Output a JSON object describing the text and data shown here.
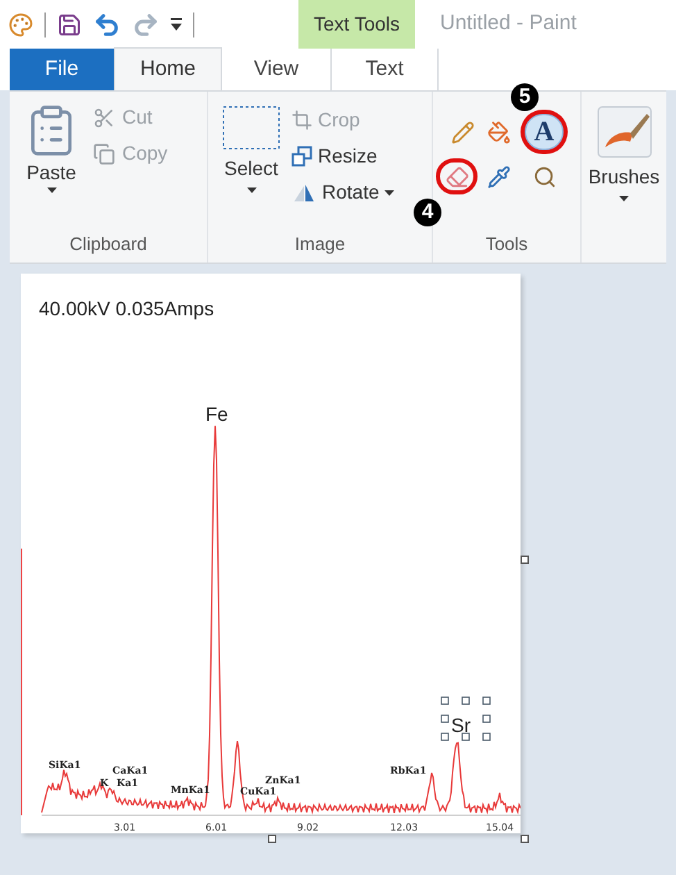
{
  "quick_access": [
    {
      "kind": "save",
      "disabled": false
    },
    {
      "kind": "undo",
      "disabled": false
    },
    {
      "kind": "redo",
      "disabled": true
    }
  ],
  "contextual_tab": {
    "label": "Text Tools"
  },
  "window": {
    "title": "Untitled - Paint"
  },
  "tabs": [
    {
      "label": "File",
      "kind": "file",
      "selected": false
    },
    {
      "label": "Home",
      "kind": "tab",
      "selected": true
    },
    {
      "label": "View",
      "kind": "tab",
      "selected": false
    },
    {
      "label": "Text",
      "kind": "tab",
      "selected": false
    }
  ],
  "clipboard": {
    "label": "Clipboard",
    "paste": "Paste",
    "cut": {
      "label": "Cut",
      "disabled": true
    },
    "copy": {
      "label": "Copy",
      "disabled": true
    }
  },
  "image": {
    "label": "Image",
    "select": "Select",
    "crop": {
      "label": "Crop",
      "disabled": true
    },
    "resize": {
      "label": "Resize",
      "disabled": false
    },
    "rotate": {
      "label": "Rotate",
      "disabled": false
    }
  },
  "tools": {
    "label": "Tools",
    "text_glyph": "A",
    "callouts": [
      {
        "label": "4"
      },
      {
        "label": "5"
      }
    ]
  },
  "brushes": {
    "label": "Brushes"
  },
  "canvas": {
    "header": "40.00kV 0.035Amps",
    "element_labels": [
      {
        "text": "Fe",
        "selected": false
      },
      {
        "text": "Sr",
        "selected": true
      }
    ],
    "peak_labels": [
      "SiKa1",
      "K",
      "CaKa1",
      "Ka1",
      "MnKa1",
      "CuKa1",
      "ZnKa1",
      "RbKa1"
    ],
    "x_tick_labels": [
      "3.01",
      "6.01",
      "9.02",
      "12.03",
      "15.04"
    ]
  }
}
